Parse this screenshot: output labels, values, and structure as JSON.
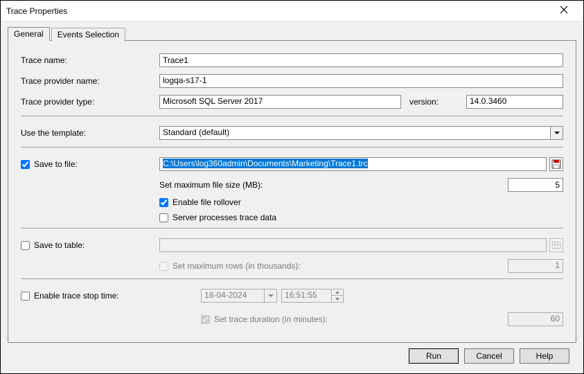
{
  "window": {
    "title": "Trace Properties"
  },
  "tabs": {
    "general": "General",
    "events": "Events Selection"
  },
  "labels": {
    "trace_name": "Trace name:",
    "trace_provider_name": "Trace provider name:",
    "trace_provider_type": "Trace provider type:",
    "version": "version:",
    "use_template": "Use the template:",
    "save_to_file": "Save to file:",
    "set_max_file": "Set maximum file size (MB):",
    "enable_rollover": "Enable file rollover",
    "server_processes": "Server processes trace data",
    "save_to_table": "Save to table:",
    "set_max_rows": "Set maximum rows (in thousands):",
    "enable_stop": "Enable trace stop time:",
    "set_duration": "Set trace duration (in minutes):"
  },
  "values": {
    "trace_name": "Trace1",
    "provider_name": "logqa-s17-1",
    "provider_type": "Microsoft SQL Server 2017",
    "version": "14.0.3460",
    "template": "Standard (default)",
    "file_path": "C:\\Users\\log360admin\\Documents\\Marketing\\Trace1.trc",
    "max_file_size": "5",
    "rollover_checked": true,
    "server_processes_checked": false,
    "save_to_file_checked": true,
    "save_to_table_checked": false,
    "max_rows": "1",
    "enable_stop_checked": false,
    "stop_date": "18-04-2024",
    "stop_time": "16:51:55",
    "duration_checked": true,
    "duration": "60"
  },
  "buttons": {
    "run": "Run",
    "cancel": "Cancel",
    "help": "Help"
  }
}
